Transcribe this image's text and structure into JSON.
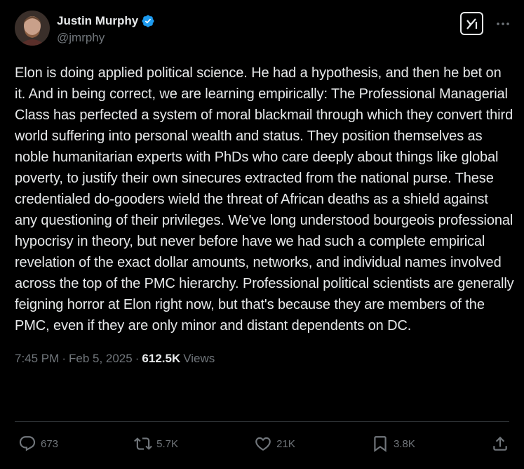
{
  "user": {
    "display_name": "Justin Murphy",
    "handle": "@jmrphy",
    "verified": true,
    "verified_color": "#1d9bf0"
  },
  "post": {
    "text": "Elon is doing applied political science. He had a hypothesis, and then he bet on it. And in being correct, we are learning empirically: The Professional Managerial Class has perfected a system of moral blackmail through which they convert third world suffering into personal wealth and status. They position themselves as noble humanitarian experts with PhDs who care deeply about things like global poverty, to justify their own sinecures extracted from the national purse. These credentialed do-gooders wield the threat of African deaths as a shield against any questioning of their privileges. We've long understood bourgeois professional hypocrisy in theory, but never before have we had such a complete empirical revelation of the exact dollar amounts, networks, and individual names involved across the top of the PMC hierarchy. Professional political scientists are generally feigning horror at Elon right now, but that's because they are members of the PMC, even if they are only minor and distant dependents on DC."
  },
  "meta": {
    "time": "7:45 PM",
    "separator": "·",
    "date": "Feb 5, 2025",
    "views_count": "612.5K",
    "views_label": "Views"
  },
  "actions": {
    "replies": "673",
    "reposts": "5.7K",
    "likes": "21K",
    "bookmarks": "3.8K"
  },
  "icons": {
    "header": [
      "grok-icon",
      "more-icon"
    ],
    "actions": [
      "reply-icon",
      "repost-icon",
      "like-icon",
      "bookmark-icon",
      "share-icon"
    ]
  },
  "colors": {
    "background": "#000000",
    "text_primary": "#e7e9ea",
    "text_secondary": "#71767b",
    "divider": "#2f3336"
  }
}
